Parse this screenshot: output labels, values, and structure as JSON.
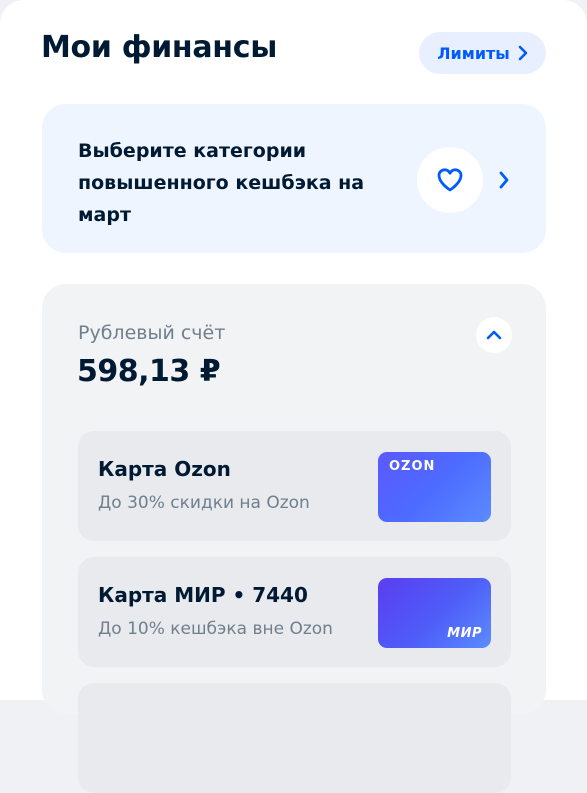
{
  "header": {
    "title": "Мои финансы",
    "limits_label": "Лимиты"
  },
  "cashback_banner": {
    "text": "Выберите категории повышенного кешбэка на март",
    "icon": "heart-icon"
  },
  "account": {
    "label": "Рублевый счёт",
    "balance": "598,13 ₽",
    "toggle_icon": "chevron-up-icon"
  },
  "cards": [
    {
      "name": "Карта Ozon",
      "description": "До 30% скидки на Ozon",
      "logo_text": "OZON"
    },
    {
      "name": "Карта МИР • 7440",
      "description": "До 10% кешбэка вне Ozon",
      "logo_text": "МИР"
    }
  ],
  "colors": {
    "accent": "#005bff",
    "text_primary": "#001a34",
    "text_secondary": "#707f8d",
    "banner_bg": "#eef5ff",
    "card_bg": "#f2f3f5"
  }
}
